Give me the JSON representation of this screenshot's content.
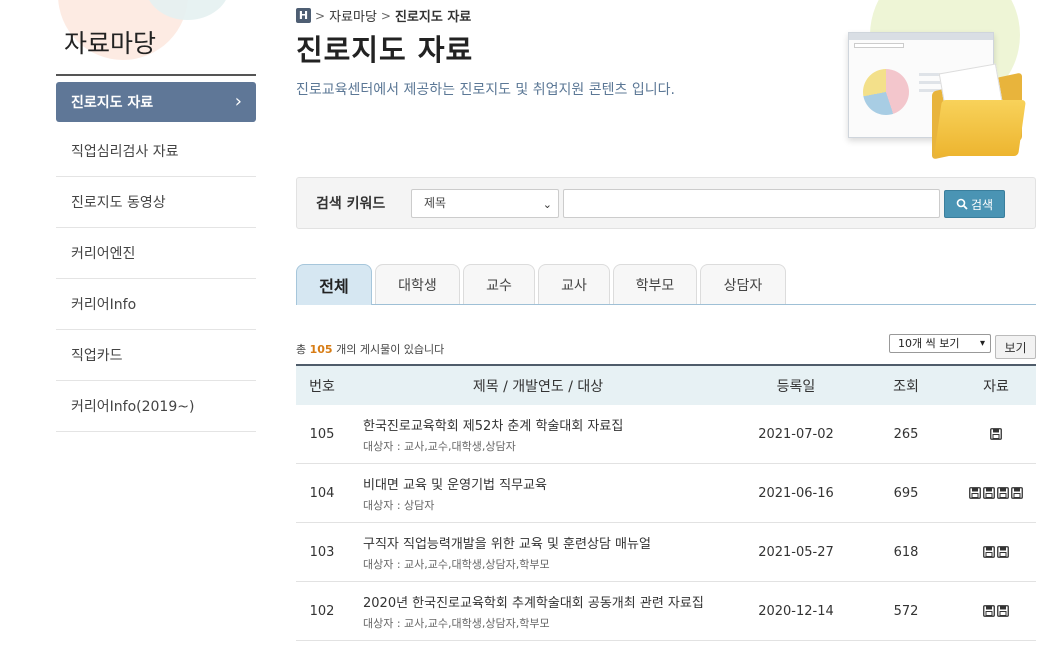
{
  "sidebar": {
    "title": "자료마당",
    "items": [
      {
        "label": "진로지도 자료",
        "active": true
      },
      {
        "label": "직업심리검사 자료"
      },
      {
        "label": "진로지도 동영상"
      },
      {
        "label": "커리어엔진"
      },
      {
        "label": "커리어Info"
      },
      {
        "label": "직업카드"
      },
      {
        "label": "커리어Info(2019~)"
      }
    ]
  },
  "breadcrumb": {
    "home_icon": "H",
    "sep": ">",
    "items": [
      "자료마당",
      "진로지도 자료"
    ]
  },
  "page": {
    "title": "진로지도 자료",
    "description": "진로교육센터에서 제공하는 진로지도 및 취업지원 콘텐츠 입니다."
  },
  "search": {
    "label": "검색 키워드",
    "select_value": "제목",
    "input_value": "",
    "button_label": "검색"
  },
  "tabs": [
    {
      "label": "전체",
      "active": true
    },
    {
      "label": "대학생"
    },
    {
      "label": "교수"
    },
    {
      "label": "교사"
    },
    {
      "label": "학부모"
    },
    {
      "label": "상담자"
    }
  ],
  "list": {
    "count_prefix": "총",
    "count": "105",
    "count_suffix": "개의 게시물이 있습니다",
    "view_select": "10개 씩 보기",
    "view_button": "보기"
  },
  "table": {
    "headers": [
      "번호",
      "제목 / 개발연도 / 대상",
      "등록일",
      "조회",
      "자료"
    ],
    "rows": [
      {
        "no": "105",
        "title": "한국진로교육학회 제52차 춘계 학술대회 자료집",
        "target": "대상자 : 교사,교수,대학생,상담자",
        "date": "2021-07-02",
        "views": "265",
        "files": 1
      },
      {
        "no": "104",
        "title": "비대면 교육 및 운영기법 직무교육",
        "target": "대상자 : 상담자",
        "date": "2021-06-16",
        "views": "695",
        "files": 4
      },
      {
        "no": "103",
        "title": "구직자 직업능력개발을 위한 교육 및 훈련상담 매뉴얼",
        "target": "대상자 : 교사,교수,대학생,상담자,학부모",
        "date": "2021-05-27",
        "views": "618",
        "files": 2
      },
      {
        "no": "102",
        "title": "2020년 한국진로교육학회 추계학술대회 공동개최 관련 자료집",
        "target": "대상자 : 교사,교수,대학생,상담자,학부모",
        "date": "2020-12-14",
        "views": "572",
        "files": 2
      }
    ]
  },
  "colors": {
    "sidebar_active": "#5f7797",
    "search_button": "#4a94b4",
    "count_number": "#d77c14",
    "tab_active": "#d6e7f2",
    "header_bg": "#e7f1f4"
  }
}
